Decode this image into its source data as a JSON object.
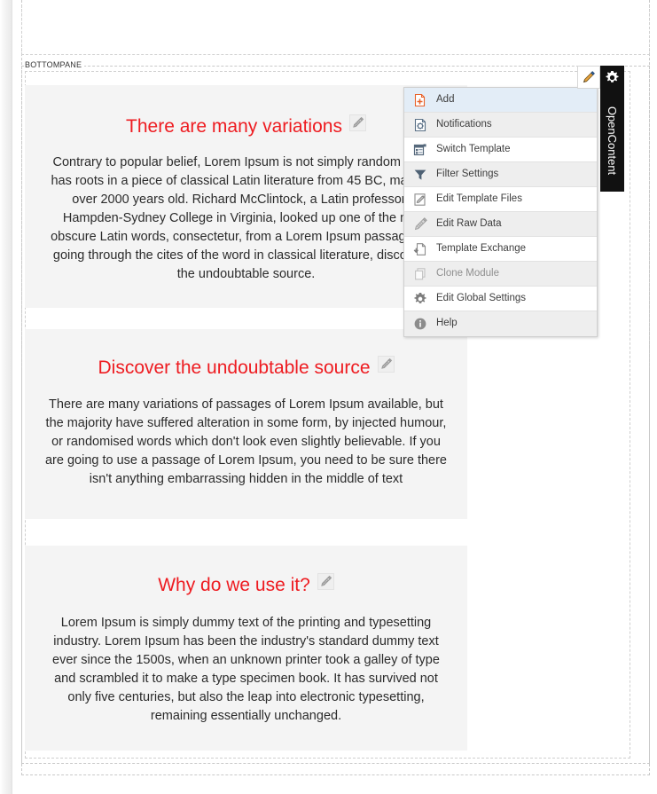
{
  "panes": {
    "bottom_label": "BOTTOMPANE"
  },
  "toolbar": {
    "pencil_icon": "pencil-icon",
    "gear_icon": "gear-icon",
    "vertical_tab_label": "OpenContent"
  },
  "menu": {
    "items": [
      {
        "label": "Add",
        "icon": "add-document-icon",
        "state": "hover"
      },
      {
        "label": "Notifications",
        "icon": "notifications-icon",
        "state": "alt"
      },
      {
        "label": "Switch Template",
        "icon": "switch-template-icon",
        "state": "normal"
      },
      {
        "label": "Filter Settings",
        "icon": "filter-icon",
        "state": "alt"
      },
      {
        "label": "Edit Template Files",
        "icon": "edit-template-files-icon",
        "state": "normal"
      },
      {
        "label": "Edit Raw Data",
        "icon": "edit-raw-data-icon",
        "state": "alt"
      },
      {
        "label": "Template Exchange",
        "icon": "template-exchange-icon",
        "state": "normal"
      },
      {
        "label": "Clone Module",
        "icon": "clone-module-icon",
        "state": "alt-disabled"
      },
      {
        "label": "Edit Global Settings",
        "icon": "settings-gear-icon",
        "state": "normal"
      },
      {
        "label": "Help",
        "icon": "help-info-icon",
        "state": "alt"
      }
    ]
  },
  "blocks": [
    {
      "title": "There are many variations",
      "body": "Contrary to popular belief, Lorem Ipsum is not simply random text. It has roots in a piece of classical Latin literature from 45 BC, making it over 2000 years old. Richard McClintock, a Latin professor at Hampden-Sydney College in Virginia, looked up one of the more obscure Latin words, consectetur, from a Lorem Ipsum passage, and going through the cites of the word in classical literature, discovered the undoubtable source."
    },
    {
      "title": "Discover the undoubtable source",
      "body": "There are many variations of passages of Lorem Ipsum available, but the majority have suffered alteration in some form, by injected humour, or randomised words which don't look even slightly believable. If you are going to use a passage of Lorem Ipsum, you need to be sure there isn't anything embarrassing hidden in the middle of text"
    },
    {
      "title": "Why do we use it?",
      "body": "Lorem Ipsum is simply dummy text of the printing and typesetting industry. Lorem Ipsum has been the industry's standard dummy text ever since the 1500s, when an unknown printer took a galley of type and scrambled it to make a type specimen book. It has survived not only five centuries, but also the leap into electronic typesetting, remaining essentially unchanged."
    }
  ],
  "colors": {
    "heading_red": "#ee1c21",
    "block_bg": "#f4f4f4",
    "menu_hover": "#e3edf7",
    "menu_alt": "#eeeeee",
    "tab_black": "#111111",
    "add_icon_orange": "#e8622a"
  }
}
